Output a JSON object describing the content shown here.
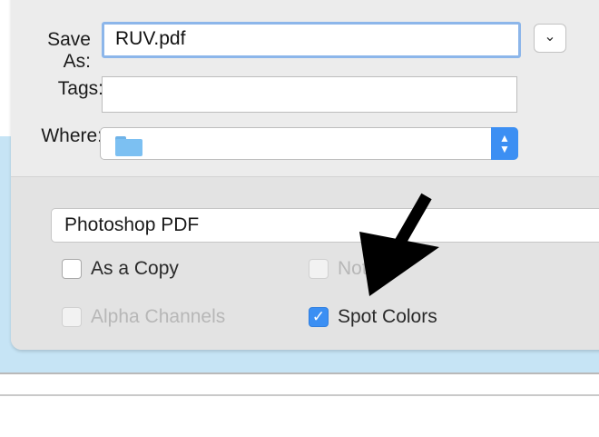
{
  "save_as": {
    "label": "Save As:",
    "value": "RUV.pdf"
  },
  "tags": {
    "label": "Tags:",
    "value": ""
  },
  "where": {
    "label": "Where:",
    "value": ""
  },
  "expand_icon": "chevron-down-icon",
  "format": {
    "value": "Photoshop PDF"
  },
  "options": [
    {
      "label": "As a Copy",
      "checked": false,
      "enabled": true
    },
    {
      "label": "Not",
      "checked": false,
      "enabled": false
    },
    {
      "label": "Alpha Channels",
      "checked": false,
      "enabled": false
    },
    {
      "label": "Spot Colors",
      "checked": true,
      "enabled": true
    }
  ],
  "colors": {
    "accent": "#3b8ff3",
    "focus_ring": "#8cb6ea",
    "arrow": "#000000"
  }
}
